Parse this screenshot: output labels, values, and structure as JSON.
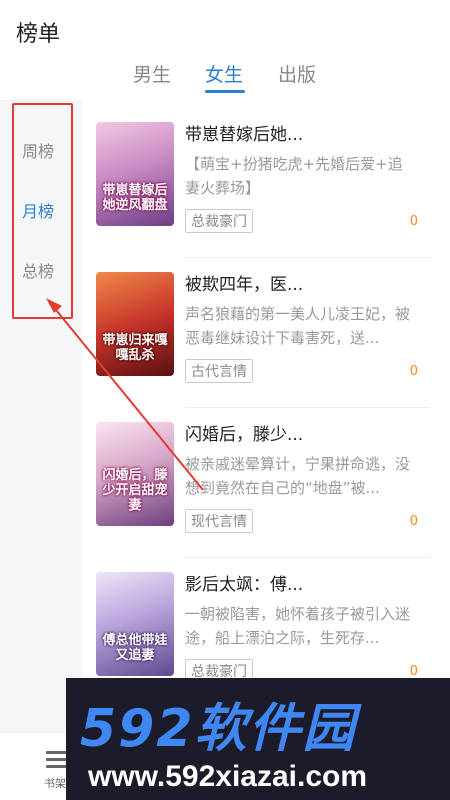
{
  "page_title": "榜单",
  "tabs": [
    {
      "label": "男生"
    },
    {
      "label": "女生",
      "active": true
    },
    {
      "label": "出版"
    }
  ],
  "sidebar": {
    "items": [
      {
        "label": "周榜"
      },
      {
        "label": "月榜",
        "active": true
      },
      {
        "label": "总榜"
      }
    ]
  },
  "books": [
    {
      "title": "带崽替嫁后她...",
      "description": "【萌宝+扮猪吃虎+先婚后爱+追妻火葬场】",
      "tag": "总裁豪门",
      "count": "0",
      "cover_text": "带崽替嫁后她逆风翻盘",
      "cover_colors": [
        "#e9b7d6",
        "#8f4d9c"
      ]
    },
    {
      "title": "被欺四年，医...",
      "description": "声名狼藉的第一美人儿凌王妃，被恶毒继妹设计下毒害死，送...",
      "tag": "古代言情",
      "count": "0",
      "cover_text": "带崽归来嘎嘎乱杀",
      "cover_colors": [
        "#e4533a",
        "#7a1a16"
      ]
    },
    {
      "title": "闪婚后，滕少...",
      "description": "被亲戚迷晕算计，宁果拼命逃，没想到竟然在自己的“地盘”被...",
      "tag": "现代言情",
      "count": "0",
      "cover_text": "闪婚后，滕少开启甜宠妻",
      "cover_colors": [
        "#f2d6e6",
        "#7c4d8d"
      ]
    },
    {
      "title": "影后太飒：傅...",
      "description": "一朝被陷害，她怀着孩子被引入迷途，船上漂泊之际，生死存...",
      "tag": "总裁豪门",
      "count": "0",
      "cover_text": "傅总他带娃又追妻",
      "cover_colors": [
        "#ddd0ef",
        "#6b4f96"
      ]
    }
  ],
  "bottom_nav": {
    "label": "书架"
  },
  "watermark": {
    "main": "592软件园",
    "url": "www.592xiazai.com"
  },
  "colors": {
    "accent": "#2a7fd4",
    "highlight": "#e63b35",
    "count": "#f08a24"
  }
}
